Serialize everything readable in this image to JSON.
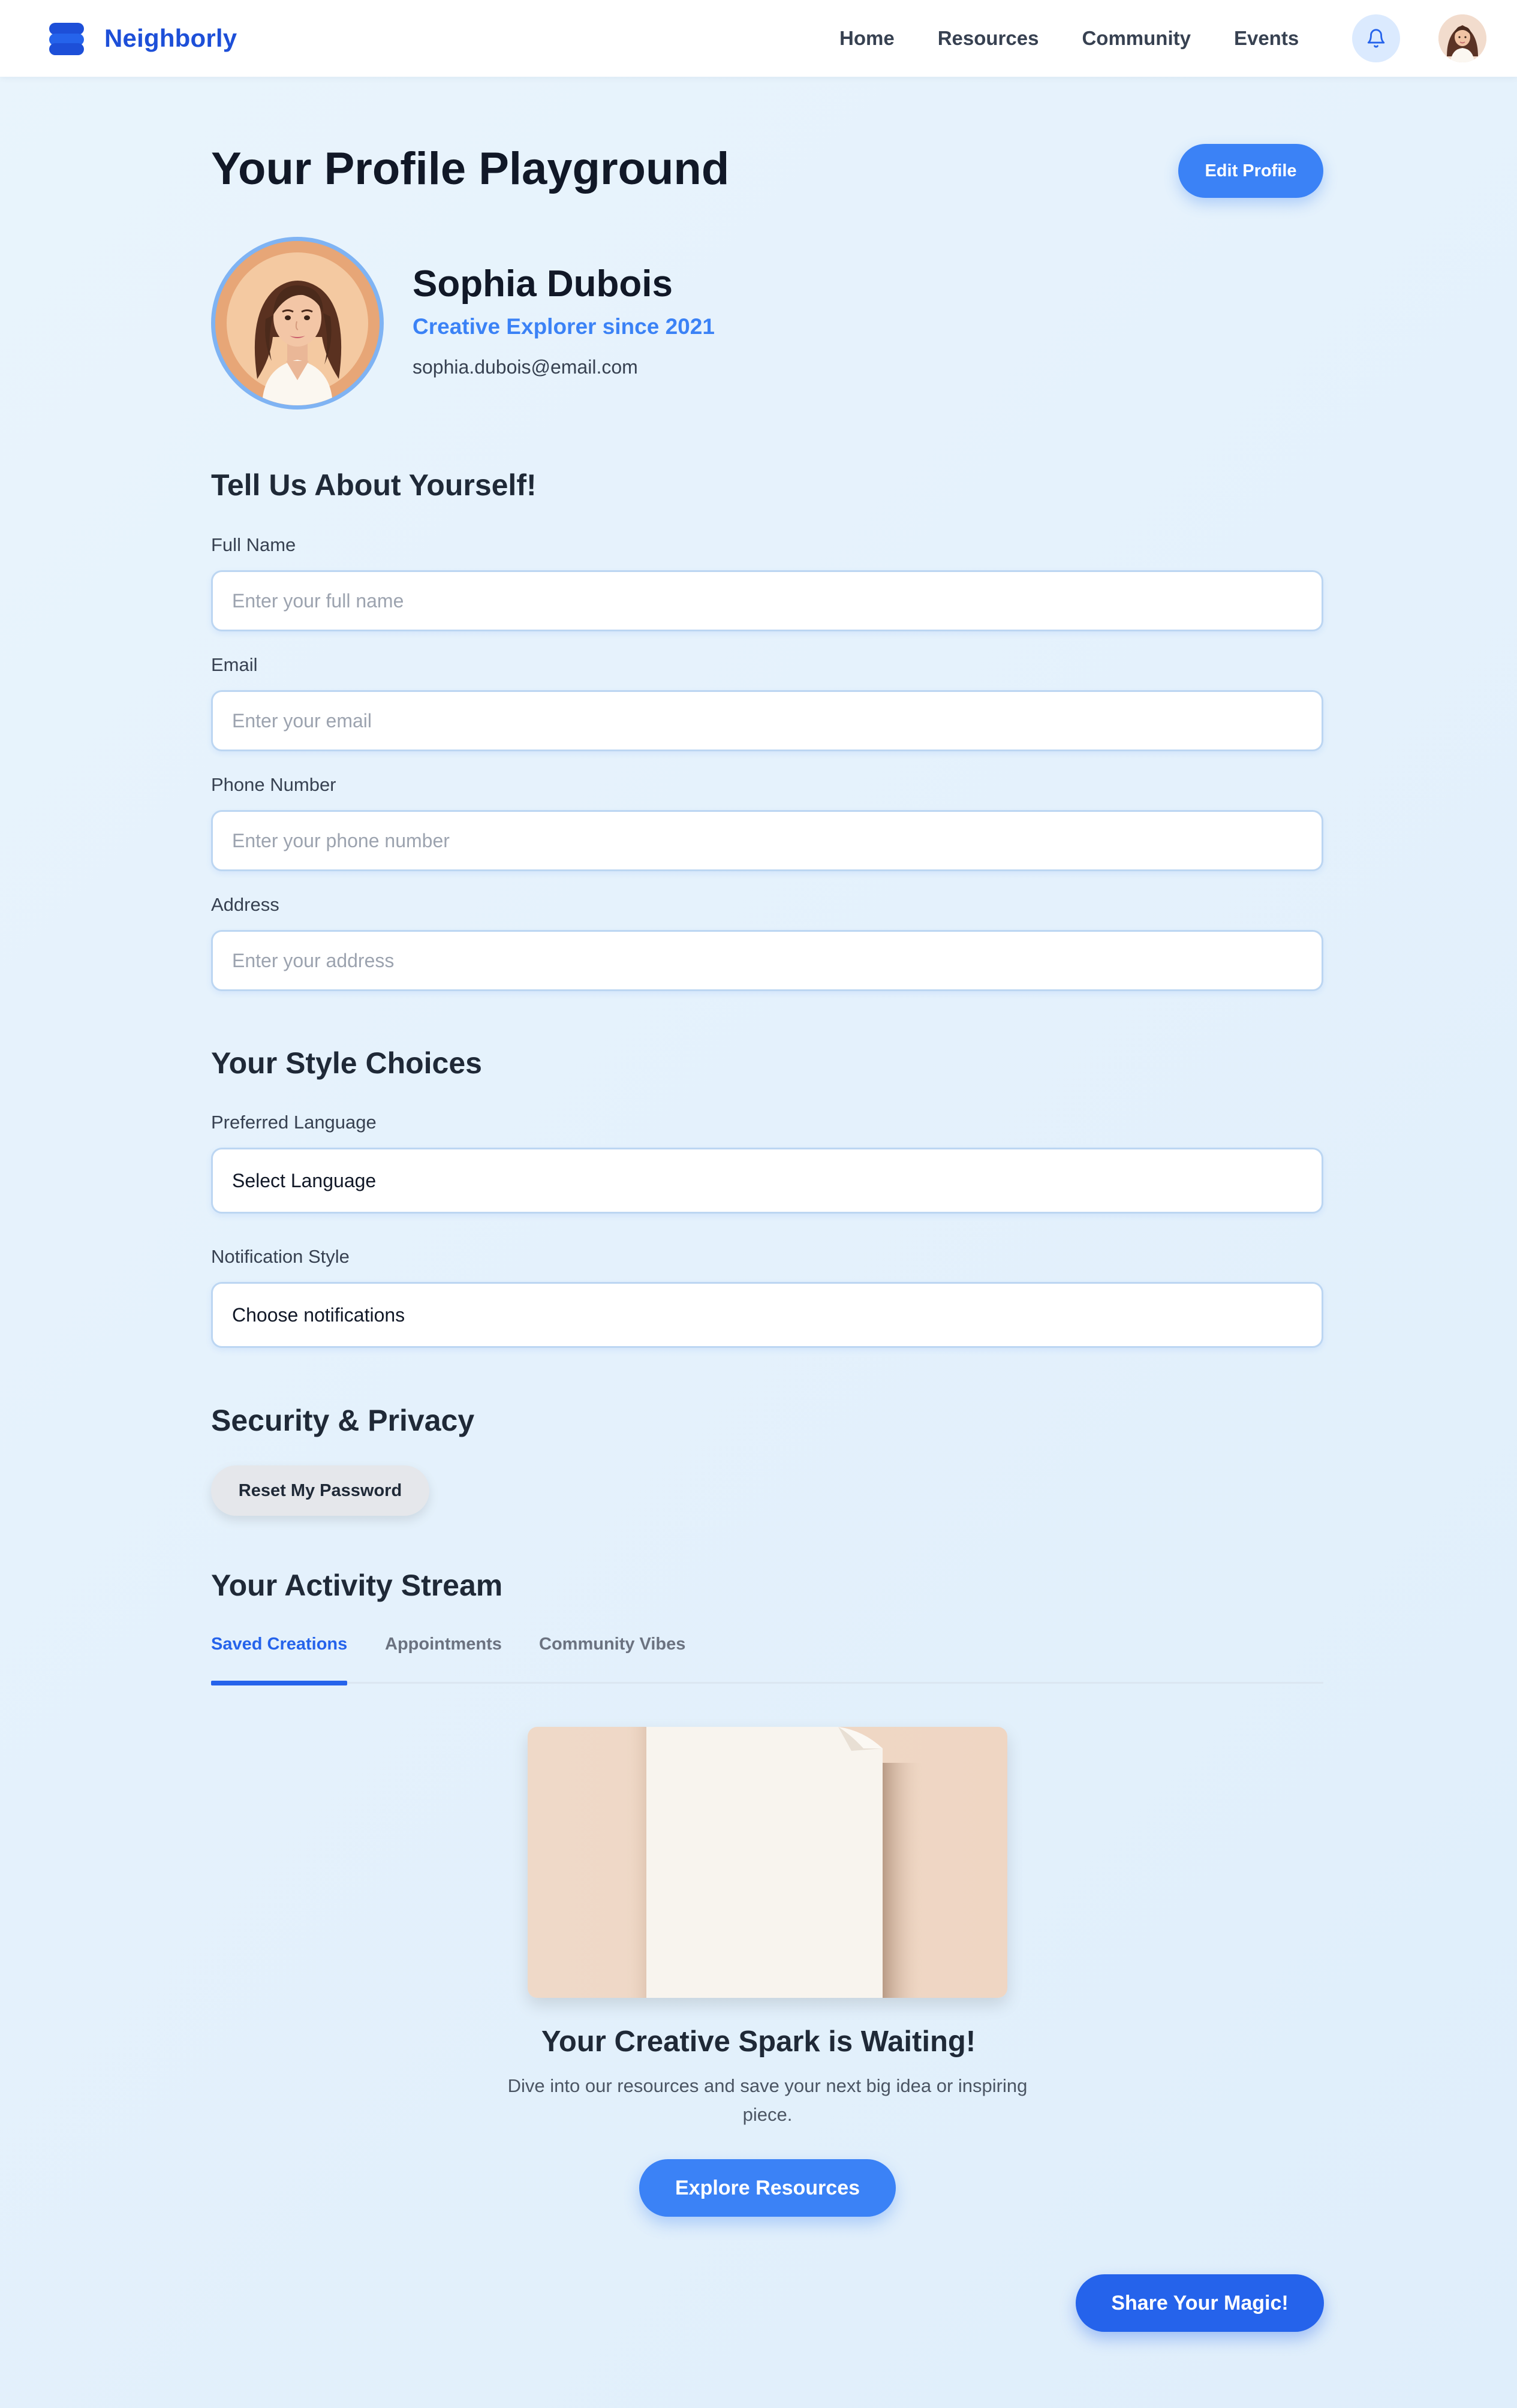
{
  "nav": {
    "brand": "Neighborly",
    "links": [
      "Home",
      "Resources",
      "Community",
      "Events"
    ],
    "bell_icon": "bell-icon",
    "avatar": "user-avatar"
  },
  "header": {
    "title": "Your Profile Playground",
    "edit_button": "Edit Profile"
  },
  "profile": {
    "name": "Sophia Dubois",
    "tagline": "Creative Explorer since 2021",
    "email": "sophia.dubois@email.com"
  },
  "about": {
    "title": "Tell Us About Yourself!",
    "fields": [
      {
        "label": "Full Name",
        "placeholder": "Enter your full name",
        "value": ""
      },
      {
        "label": "Email",
        "placeholder": "Enter your email",
        "value": ""
      },
      {
        "label": "Phone Number",
        "placeholder": "Enter your phone number",
        "value": ""
      },
      {
        "label": "Address",
        "placeholder": "Enter your address",
        "value": ""
      }
    ]
  },
  "style": {
    "title": "Your Style Choices",
    "language_label": "Preferred Language",
    "language_value": "Select Language",
    "notification_label": "Notification Style",
    "notification_value": "Choose notifications"
  },
  "security": {
    "title": "Security & Privacy",
    "reset_button": "Reset My Password"
  },
  "activity": {
    "title": "Your Activity Stream",
    "tabs": [
      "Saved Creations",
      "Appointments",
      "Community Vibes"
    ],
    "active_tab": "Saved Creations",
    "empty_title": "Your Creative Spark is Waiting!",
    "empty_desc": "Dive into our resources and save your next big idea or inspiring piece.",
    "explore_button": "Explore Resources"
  },
  "share_button": "Share Your Magic!",
  "colors": {
    "brand": "#1d4fd8",
    "accent": "#3b82f6",
    "primary_dark": "#2563eb",
    "background": "#e9f4fc"
  }
}
